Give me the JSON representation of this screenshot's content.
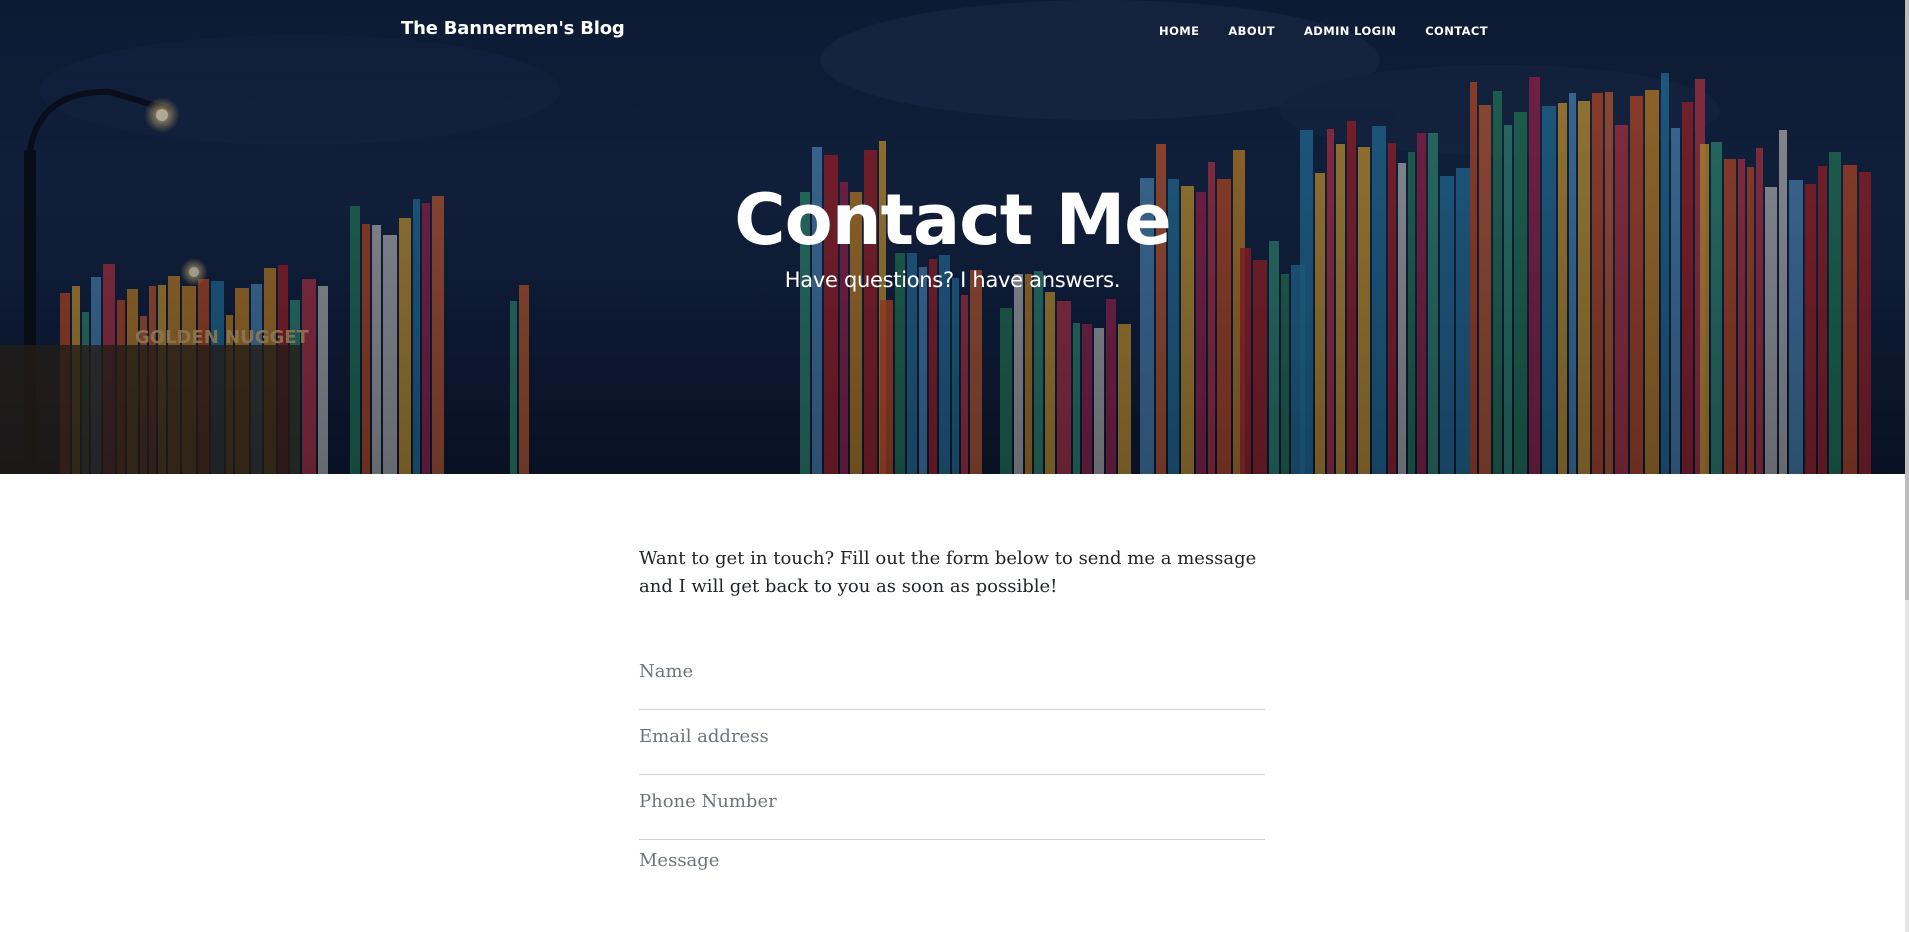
{
  "nav": {
    "brand": "The Bannermen's Blog",
    "links": [
      "HOME",
      "ABOUT",
      "ADMIN LOGIN",
      "CONTACT"
    ]
  },
  "hero": {
    "title": "Contact Me",
    "subtitle": "Have questions? I have answers.",
    "sign_text": "GOLDEN NUGGET"
  },
  "main": {
    "intro": "Want to get in touch? Fill out the form below to send me a message and I will get back to you as soon as possible!",
    "fields": {
      "name_placeholder": "Name",
      "email_placeholder": "Email address",
      "phone_placeholder": "Phone Number",
      "message_placeholder": "Message"
    }
  },
  "colors": {
    "hero_sky": "#14264a",
    "text": "#212529",
    "placeholder": "#6c757d",
    "divider": "#ced4da"
  }
}
